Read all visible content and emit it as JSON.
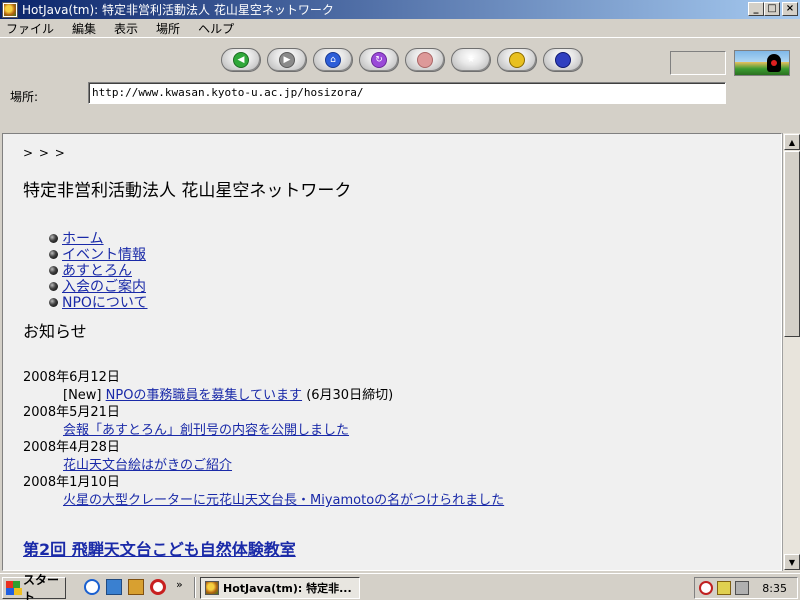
{
  "window": {
    "title": "HotJava(tm): 特定非営利活動法人 花山星空ネットワーク",
    "minimize": "_",
    "maximize": "□",
    "close": "×"
  },
  "menu": [
    "ファイル",
    "編集",
    "表示",
    "場所",
    "ヘルプ"
  ],
  "toolbar": {
    "buttons": [
      "back-icon",
      "forward-icon",
      "home-icon",
      "reload-icon",
      "stop-icon",
      "bookmark-star-icon",
      "search-icon",
      "print-icon"
    ],
    "address_label": "場所:",
    "address_value": "http://www.kwasan.kyoto-u.ac.jp/hosizora/"
  },
  "page": {
    "prompt": "> > >",
    "heading": "特定非営利活動法人 花山星空ネットワーク",
    "nav": [
      "ホーム",
      "イベント情報",
      "あすとろん",
      "入会のご案内",
      "NPOについて"
    ],
    "news_title": "お知らせ",
    "news": [
      {
        "date": "2008年6月12日",
        "prefix": "[New] ",
        "link": "NPOの事務職員を募集しています",
        "suffix": " (6月30日締切)"
      },
      {
        "date": "2008年5月21日",
        "prefix": "",
        "link": "会報「あすとろん」創刊号の内容を公開しました",
        "suffix": ""
      },
      {
        "date": "2008年4月28日",
        "prefix": "",
        "link": "花山天文台絵はがきのご紹介",
        "suffix": ""
      },
      {
        "date": "2008年1月10日",
        "prefix": "",
        "link": "火星の大型クレーターに元花山天文台長・Miyamotoの名がつけられました",
        "suffix": ""
      }
    ],
    "section_link": "第2回 飛騨天文台こども自然体験教室"
  },
  "taskbar": {
    "start": "スタート",
    "chevron": "»",
    "task": "HotJava(tm): 特定非...",
    "clock": "8:35"
  }
}
